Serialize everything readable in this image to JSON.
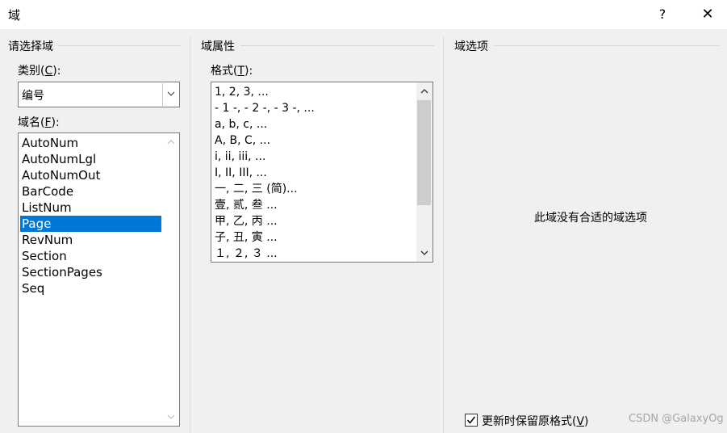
{
  "window": {
    "title": "域",
    "help_label": "?",
    "close_label": "✕"
  },
  "select_field": {
    "group_title": "请选择域",
    "category_label_prefix": "类别(",
    "category_label_key": "C",
    "category_label_suffix": "):",
    "category_value": "编号",
    "fieldname_label_prefix": "域名(",
    "fieldname_label_key": "F",
    "fieldname_label_suffix": "):",
    "field_names": [
      {
        "label": "AutoNum",
        "selected": false
      },
      {
        "label": "AutoNumLgl",
        "selected": false
      },
      {
        "label": "AutoNumOut",
        "selected": false
      },
      {
        "label": "BarCode",
        "selected": false
      },
      {
        "label": "ListNum",
        "selected": false
      },
      {
        "label": "Page",
        "selected": true
      },
      {
        "label": "RevNum",
        "selected": false
      },
      {
        "label": "Section",
        "selected": false
      },
      {
        "label": "SectionPages",
        "selected": false
      },
      {
        "label": "Seq",
        "selected": false
      }
    ]
  },
  "field_properties": {
    "group_title": "域属性",
    "format_label_prefix": "格式(",
    "format_label_key": "T",
    "format_label_suffix": "):",
    "formats": [
      "1, 2, 3, ...",
      "- 1 -, - 2 -, - 3 -, ...",
      "a, b, c, ...",
      "A, B, C, ...",
      "i, ii, iii, ...",
      "I, II, III, ...",
      "一, 二, 三 (简)...",
      "壹, 贰, 叁 ...",
      "甲, 乙, 丙 ...",
      "子, 丑, 寅 ...",
      "１, ２, ３ ..."
    ]
  },
  "field_options": {
    "group_title": "域选项",
    "empty_message": "此域没有合适的域选项",
    "preserve_format_prefix": "更新时保留原格式(",
    "preserve_format_key": "V",
    "preserve_format_suffix": ")",
    "preserve_format_checked": true
  },
  "watermark": "CSDN @GalaxyOg",
  "icons": {
    "combo_arrow": "chevron-down-icon",
    "scroll_up": "scroll-up-arrow-icon",
    "scroll_down": "scroll-down-arrow-icon",
    "check": "checkmark-icon"
  }
}
